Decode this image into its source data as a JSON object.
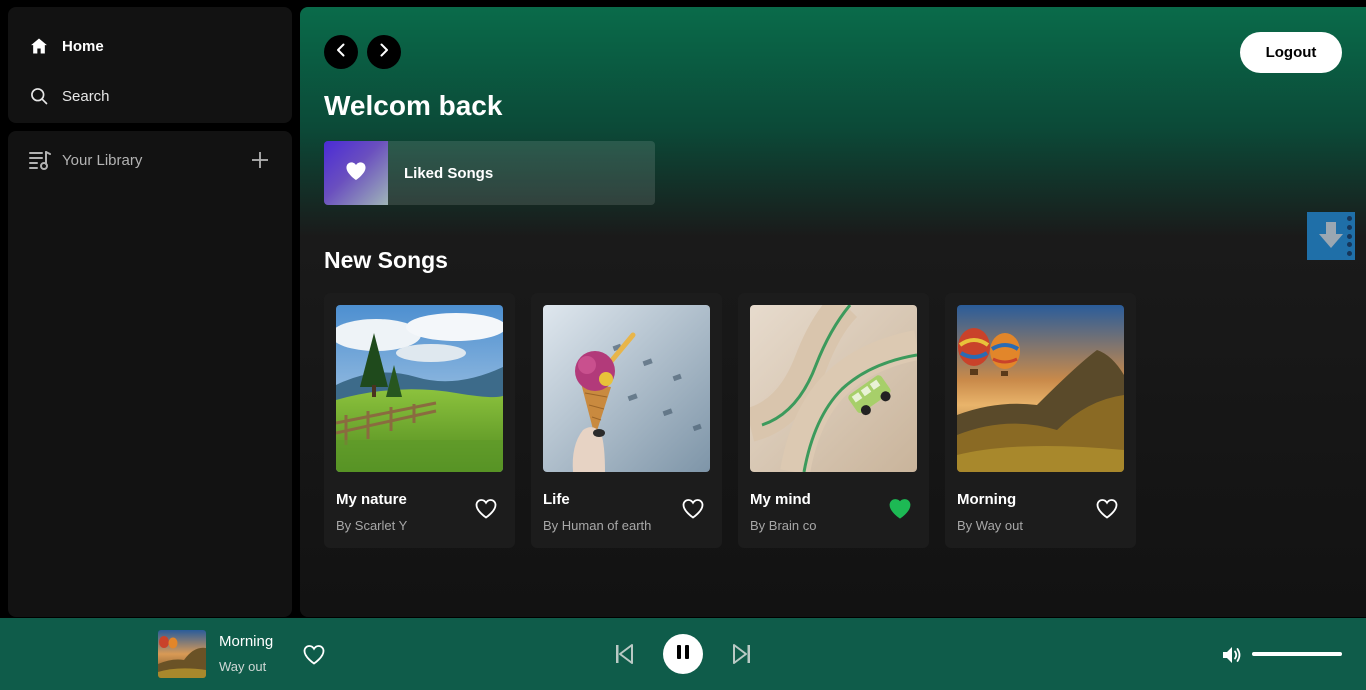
{
  "nav": {
    "home_label": "Home",
    "search_label": "Search"
  },
  "library": {
    "label": "Your Library"
  },
  "header": {
    "logout_label": "Logout",
    "welcome": "Welcom back"
  },
  "liked": {
    "title": "Liked Songs"
  },
  "new_songs": {
    "title": "New Songs",
    "items": [
      {
        "title": "My nature",
        "subtitle": "By Scarlet Y",
        "liked": false
      },
      {
        "title": "Life",
        "subtitle": "By Human of earth",
        "liked": false
      },
      {
        "title": "My mind",
        "subtitle": "By Brain co",
        "liked": true
      },
      {
        "title": "Morning",
        "subtitle": "By Way out",
        "liked": false
      }
    ]
  },
  "player": {
    "title": "Morning",
    "artist": "Way out",
    "volume": 1.0,
    "state": "playing"
  },
  "colors": {
    "accent": "#1db954",
    "player_bg": "#0f5c4a",
    "header_gradient_top": "#0a6b4a"
  },
  "icons": {
    "home": "home-icon",
    "search": "search-icon",
    "library": "library-icon",
    "add": "plus-icon",
    "back": "chevron-left-icon",
    "forward": "chevron-right-icon",
    "heart": "heart-icon",
    "download": "download-icon",
    "prev": "skip-back-icon",
    "pause": "pause-icon",
    "next": "skip-forward-icon",
    "volume": "volume-icon"
  }
}
